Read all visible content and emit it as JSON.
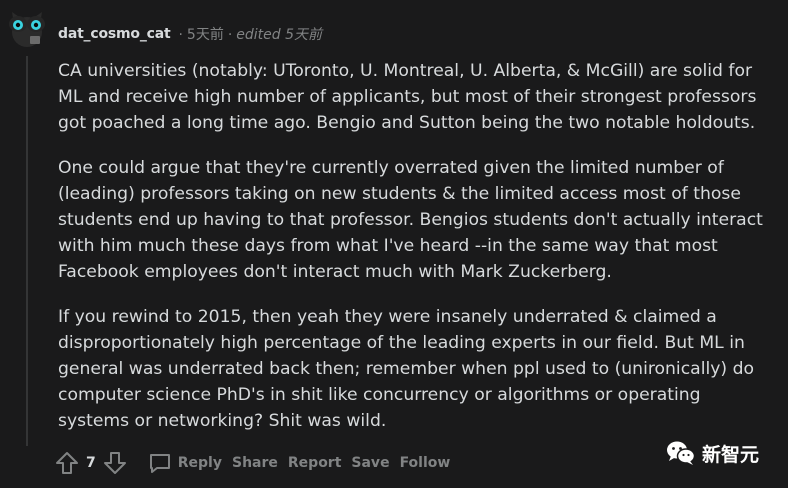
{
  "comment": {
    "author": "dat_cosmo_cat",
    "separator": "·",
    "time": "5天前",
    "edited": "edited 5天前",
    "paragraphs": [
      "CA universities (notably: UToronto, U. Montreal, U. Alberta, & McGill) are solid for ML and receive high number of applicants, but most of their strongest professors got poached a long time ago. Bengio and Sutton being the two notable holdouts.",
      "One could argue that they're currently overrated given the limited number of (leading) professors taking on new students & the limited access most of those students end up having to that professor. Bengios students don't actually interact with him much these days from what I've heard --in the same way that most Facebook employees don't interact much with Mark Zuckerberg.",
      "If you rewind to 2015, then yeah they were insanely underrated & claimed a disproportionately high percentage of the leading experts in our field. But ML in general was underrated back then; remember when ppl used to (unironically) do computer science PhD's in shit like concurrency or algorithms or operating systems or networking? Shit was wild."
    ],
    "score": "7"
  },
  "actions": {
    "reply": "Reply",
    "share": "Share",
    "report": "Report",
    "save": "Save",
    "follow": "Follow"
  },
  "icons": {
    "upvote": "upvote-arrow-icon",
    "downvote": "downvote-arrow-icon",
    "reply": "speech-bubble-icon",
    "avatar": "cat-avatar-icon",
    "watermark": "wechat-logo-icon"
  },
  "watermark": {
    "text": "新智元"
  },
  "colors": {
    "background": "#1a1a1b",
    "text": "#d7dadc",
    "muted": "#818384",
    "thread_line": "#343536"
  }
}
